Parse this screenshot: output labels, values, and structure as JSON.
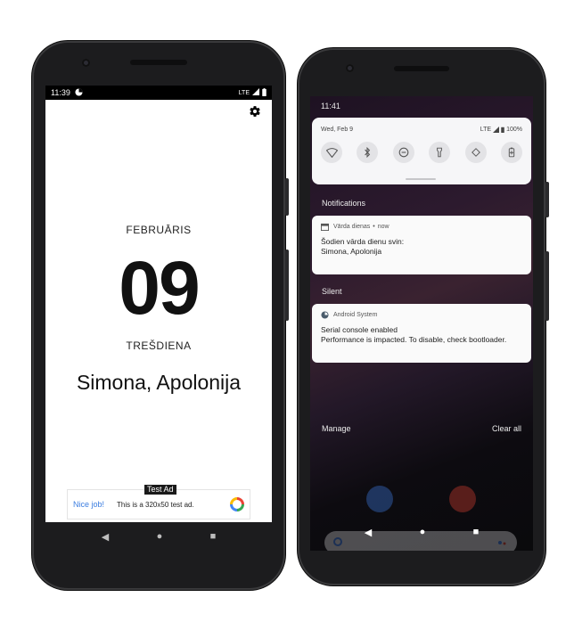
{
  "left_phone": {
    "status": {
      "time": "11:39",
      "network": "LTE"
    },
    "month": "FEBRUĀRIS",
    "day": "09",
    "weekday": "TREŠDIENA",
    "names": "Simona, Apolonija",
    "ad": {
      "tag": "Test Ad",
      "nice": "Nice job!",
      "text": "This is a 320x50 test ad."
    },
    "nav": {
      "back": "◀",
      "home": "●",
      "recents": "■"
    }
  },
  "right_phone": {
    "status": {
      "time": "11:41"
    },
    "quick_settings": {
      "date": "Wed, Feb 9",
      "network": "LTE",
      "battery": "100%"
    },
    "notifications_label": "Notifications",
    "notification": {
      "app": "Vārda dienas",
      "time": "now",
      "title": "Šodien vārda dienu svin:",
      "body": "Simona, Apolonija"
    },
    "silent_label": "Silent",
    "system_notification": {
      "app": "Android System",
      "title": "Serial console enabled",
      "body": "Performance is impacted. To disable, check bootloader."
    },
    "manage_label": "Manage",
    "clear_label": "Clear all",
    "nav": {
      "back": "◀",
      "home": "●",
      "recents": "■"
    }
  },
  "colors": {
    "accent": "#3b7de0",
    "screen_bg": "#ffffff",
    "frame": "#1c1c1e"
  }
}
